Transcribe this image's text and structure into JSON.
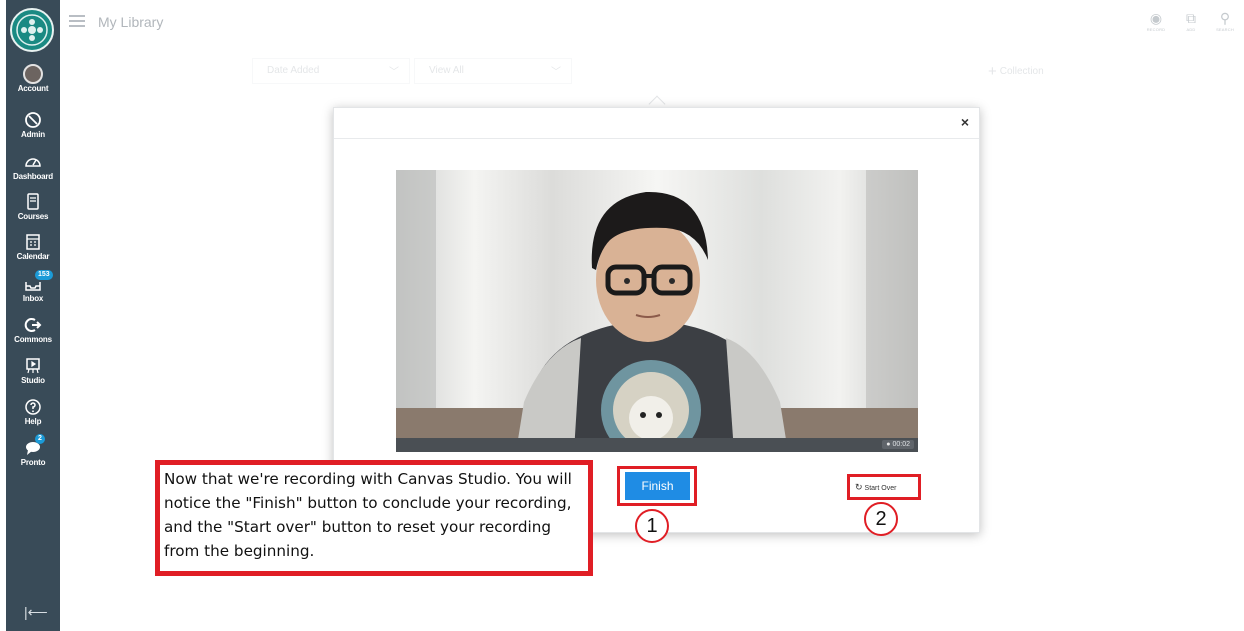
{
  "nav": {
    "items": [
      {
        "label": "Account",
        "icon": "account-avatar"
      },
      {
        "label": "Admin",
        "icon": "shield-icon"
      },
      {
        "label": "Dashboard",
        "icon": "dashboard-gauge-icon"
      },
      {
        "label": "Courses",
        "icon": "book-icon"
      },
      {
        "label": "Calendar",
        "icon": "calendar-icon"
      },
      {
        "label": "Inbox",
        "icon": "inbox-icon",
        "badge": "153"
      },
      {
        "label": "Commons",
        "icon": "commons-arrow-icon"
      },
      {
        "label": "Studio",
        "icon": "studio-icon"
      },
      {
        "label": "Help",
        "icon": "help-circle-icon"
      },
      {
        "label": "Pronto",
        "icon": "chat-bubble-icon",
        "badge": "2"
      }
    ]
  },
  "header": {
    "title": "My Library",
    "tools": [
      {
        "label": "RECORD",
        "icon": "record-icon"
      },
      {
        "label": "ADD",
        "icon": "add-media-icon"
      },
      {
        "label": "SEARCH",
        "icon": "search-icon"
      }
    ]
  },
  "filters": {
    "sort": "Date Added",
    "view": "View All",
    "add_collection": "Collection"
  },
  "modal": {
    "close": "×",
    "timecode": "00:02",
    "finish_label": "Finish",
    "start_over_label": "Start Over"
  },
  "annotation": {
    "callout": "Now that we're recording with Canvas Studio. You will notice the \"Finish\" button to conclude your recording, and the \"Start over\" button to reset your recording from the beginning.",
    "marker_1": "1",
    "marker_2": "2"
  },
  "colors": {
    "sidebar": "#394B58",
    "primary_button": "#1f8ce4",
    "annotation_red": "#e01e25",
    "badge": "#1b9bd8"
  }
}
